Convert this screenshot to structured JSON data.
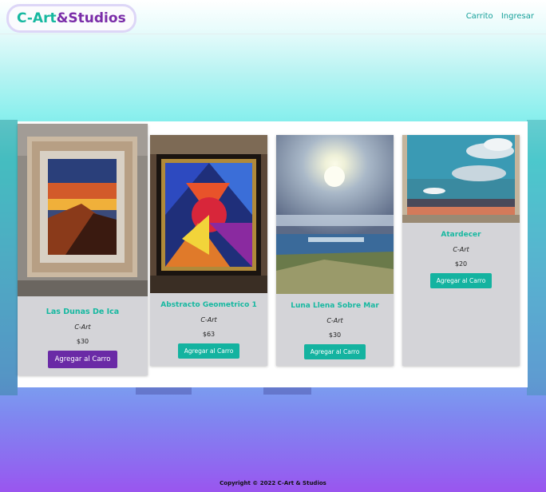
{
  "brand": {
    "part1": "C-Art",
    "part2": "&Studios"
  },
  "nav": {
    "cart": "Carrito",
    "login": "Ingresar"
  },
  "products": [
    {
      "title": "Las Dunas De Ica",
      "author": "C-Art",
      "price": "$30",
      "button": "Agregar al Carro"
    },
    {
      "title": "Abstracto Geometrico 1",
      "author": "C-Art",
      "price": "$63",
      "button": "Agregar al Carro"
    },
    {
      "title": "Luna Llena Sobre Mar",
      "author": "C-Art",
      "price": "$30",
      "button": "Agregar al Carro"
    },
    {
      "title": "Atardecer",
      "author": "C-Art",
      "price": "$20",
      "button": "Agregar al Carro"
    }
  ],
  "footer": {
    "text": "Copyright © 2022 C-Art & Studios"
  }
}
